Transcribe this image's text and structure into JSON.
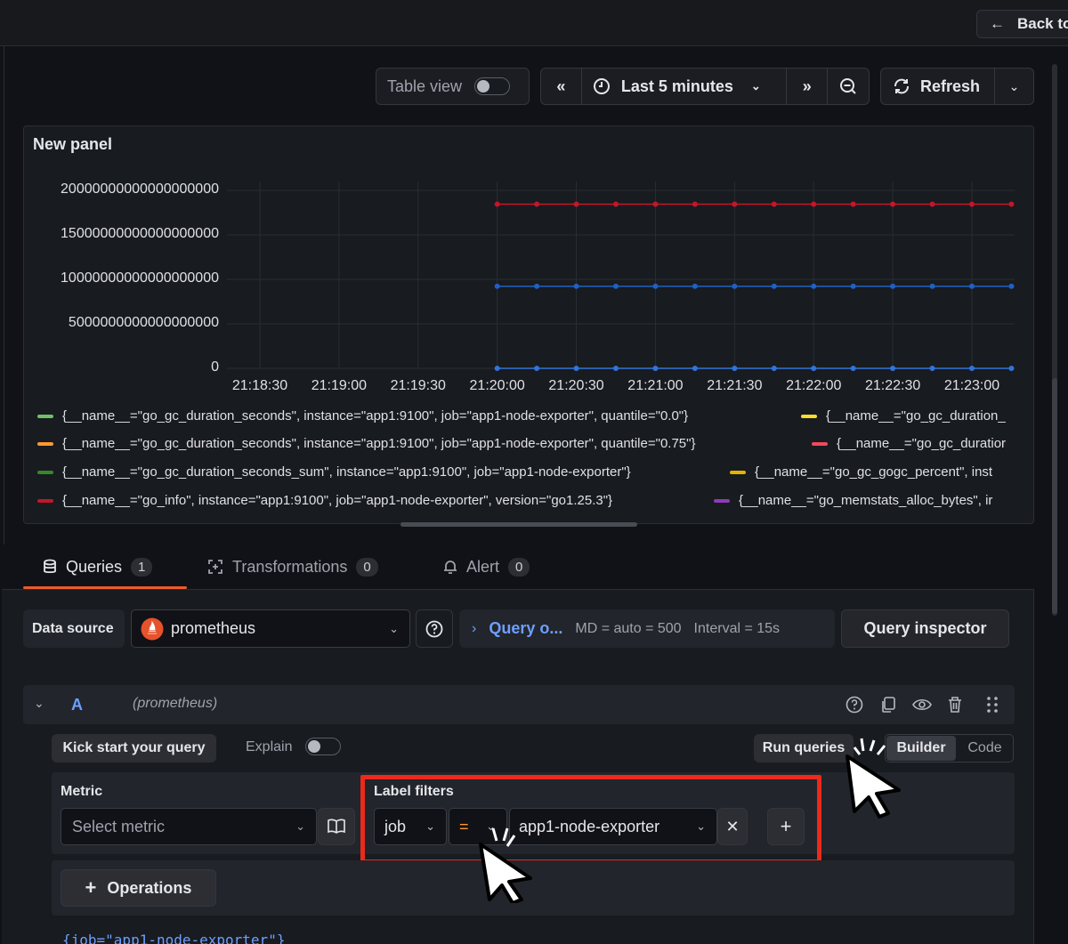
{
  "header": {
    "back_label": "Back to"
  },
  "toolbar": {
    "table_view_label": "Table view",
    "time_range_label": "Last 5 minutes",
    "refresh_label": "Refresh"
  },
  "panel": {
    "title": "New panel",
    "legend": [
      [
        {
          "color": "#73bf69",
          "text": "{__name__=\"go_gc_duration_seconds\", instance=\"app1:9100\", job=\"app1-node-exporter\", quantile=\"0.0\"}"
        },
        {
          "color": "#fade2a",
          "text": "{__name__=\"go_gc_duration_"
        }
      ],
      [
        {
          "color": "#ff9830",
          "text": "{__name__=\"go_gc_duration_seconds\", instance=\"app1:9100\", job=\"app1-node-exporter\", quantile=\"0.75\"}"
        },
        {
          "color": "#f2495c",
          "text": "{__name__=\"go_gc_duratior"
        }
      ],
      [
        {
          "color": "#37872d",
          "text": "{__name__=\"go_gc_duration_seconds_sum\", instance=\"app1:9100\", job=\"app1-node-exporter\"}"
        },
        {
          "color": "#e0b400",
          "text": "{__name__=\"go_gc_gogc_percent\", inst"
        }
      ],
      [
        {
          "color": "#c4162a",
          "text": "{__name__=\"go_info\", instance=\"app1:9100\", job=\"app1-node-exporter\", version=\"go1.25.3\"}"
        },
        {
          "color": "#8f3bb8",
          "text": "{__name__=\"go_memstats_alloc_bytes\", ir"
        }
      ]
    ]
  },
  "chart_data": {
    "type": "line",
    "ylim": [
      0,
      20000000000000000000
    ],
    "y_ticks": [
      "20000000000000000000",
      "15000000000000000000",
      "10000000000000000000",
      "5000000000000000000",
      "0"
    ],
    "x_ticks": [
      "21:18:30",
      "21:19:00",
      "21:19:30",
      "21:20:00",
      "21:20:30",
      "21:21:00",
      "21:21:30",
      "21:22:00",
      "21:22:30",
      "21:23:00"
    ],
    "x": [
      "21:20:00",
      "21:20:15",
      "21:20:30",
      "21:20:45",
      "21:21:00",
      "21:21:15",
      "21:21:30",
      "21:21:45",
      "21:22:00",
      "21:22:15",
      "21:22:30",
      "21:22:45",
      "21:23:00",
      "21:23:15"
    ],
    "series": [
      {
        "color": "#c4162a",
        "values": [
          18446744073709552000,
          18446744073709552000,
          18446744073709552000,
          18446744073709552000,
          18446744073709552000,
          18446744073709552000,
          18446744073709552000,
          18446744073709552000,
          18446744073709552000,
          18446744073709552000,
          18446744073709552000,
          18446744073709552000,
          18446744073709552000,
          18446744073709552000
        ]
      },
      {
        "color": "#1f60c4",
        "values": [
          9223372036854776000,
          9223372036854776000,
          9223372036854776000,
          9223372036854776000,
          9223372036854776000,
          9223372036854776000,
          9223372036854776000,
          9223372036854776000,
          9223372036854776000,
          9223372036854776000,
          9223372036854776000,
          9223372036854776000,
          9223372036854776000,
          9223372036854776000
        ]
      },
      {
        "color": "#3274d9",
        "values": [
          0,
          0,
          0,
          0,
          0,
          0,
          0,
          0,
          0,
          0,
          0,
          0,
          0,
          0
        ]
      }
    ]
  },
  "tabs": [
    {
      "label": "Queries",
      "count": "1"
    },
    {
      "label": "Transformations",
      "count": "0"
    },
    {
      "label": "Alert",
      "count": "0"
    }
  ],
  "datasource": {
    "label": "Data source",
    "value": "prometheus",
    "query_options": "Query o...",
    "md": "MD = auto = 500",
    "interval": "Interval = 15s",
    "inspector": "Query inspector"
  },
  "query": {
    "ref": "A",
    "source": "(prometheus)",
    "kick_start": "Kick start your query",
    "explain": "Explain",
    "run": "Run queries",
    "builder": "Builder",
    "code": "Code",
    "metric_label": "Metric",
    "metric_placeholder": "Select metric",
    "label_filters_label": "Label filters",
    "filter_label": "job",
    "filter_op": "=",
    "filter_value": "app1-node-exporter",
    "operations": "Operations",
    "code_preview": "{job=\"app1-node-exporter\"}"
  }
}
